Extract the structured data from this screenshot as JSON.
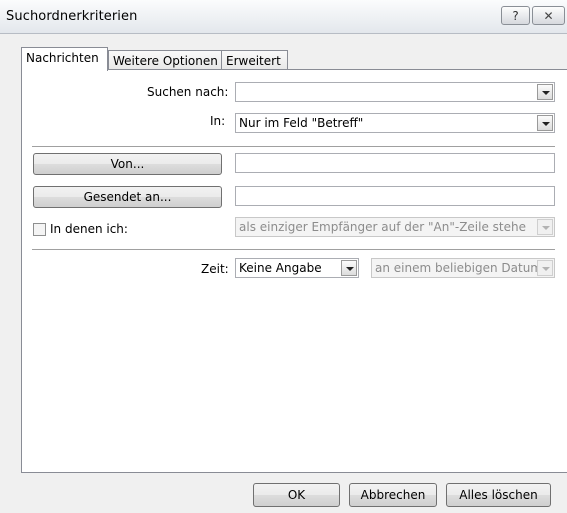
{
  "window": {
    "title": "Suchordnerkriterien",
    "help_label": "?",
    "close_label": "✕"
  },
  "tabs": [
    {
      "label": "Nachrichten",
      "active": true
    },
    {
      "label": "Weitere Optionen",
      "active": false
    },
    {
      "label": "Erweitert",
      "active": false
    }
  ],
  "form": {
    "search_label": "Suchen nach:",
    "search_value": "",
    "in_label": "In:",
    "in_value": "Nur im Feld \"Betreff\"",
    "from_button": "Von...",
    "from_value": "",
    "sent_to_button": "Gesendet an...",
    "sent_to_value": "",
    "where_i_am_label": "In denen ich:",
    "where_i_am_checked": false,
    "where_i_am_value": "als einziger Empfänger auf der \"An\"-Zeile stehe",
    "time_label": "Zeit:",
    "time_value": "Keine Angabe",
    "date_value": "an einem beliebigen Datum"
  },
  "buttons": {
    "ok": "OK",
    "cancel": "Abbrechen",
    "clear_all": "Alles löschen"
  }
}
